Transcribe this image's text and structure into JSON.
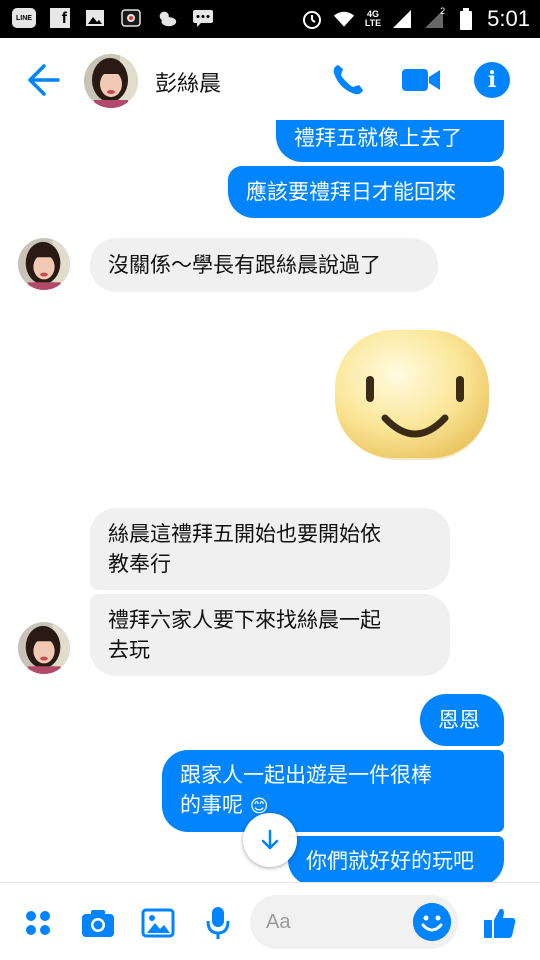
{
  "status_bar": {
    "time": "5:01",
    "network": "4G",
    "network_sub": "LTE",
    "line_label": "LINE",
    "fb_label": "f",
    "sim_label": "2"
  },
  "header": {
    "contact_name": "彭絲晨"
  },
  "messages": [
    {
      "direction": "out",
      "text": "禮拜五就像上去了"
    },
    {
      "direction": "out",
      "text": "應該要禮拜日才能回來"
    },
    {
      "direction": "in",
      "text": "沒關係～學長有跟絲晨說過了"
    },
    {
      "direction": "in",
      "sticker": "smiley-face"
    },
    {
      "direction": "in",
      "text_lines": [
        "絲晨這禮拜五開始也要開始依",
        "教奉行"
      ]
    },
    {
      "direction": "in",
      "text_lines": [
        "禮拜六家人要下來找絲晨一起",
        "去玩"
      ]
    },
    {
      "direction": "out",
      "text": "恩恩"
    },
    {
      "direction": "out",
      "text_lines": [
        "跟家人一起出遊是一件很棒",
        "的事呢"
      ],
      "emoji": "😊"
    },
    {
      "direction": "out",
      "text": "你們就好好的玩吧"
    }
  ],
  "composer": {
    "placeholder": "Aa"
  },
  "colors": {
    "accent": "#0084ff",
    "incoming_bubble": "#f1f0f0",
    "outgoing_bubble": "#0084ff"
  },
  "icons": {
    "back": "arrow-left-icon",
    "call": "phone-icon",
    "video": "video-camera-icon",
    "info": "info-icon",
    "more": "four-dots-icon",
    "camera": "camera-icon",
    "gallery": "image-icon",
    "mic": "microphone-icon",
    "emoji": "smiley-icon",
    "like": "thumbs-up-icon",
    "scroll": "arrow-down-icon"
  }
}
